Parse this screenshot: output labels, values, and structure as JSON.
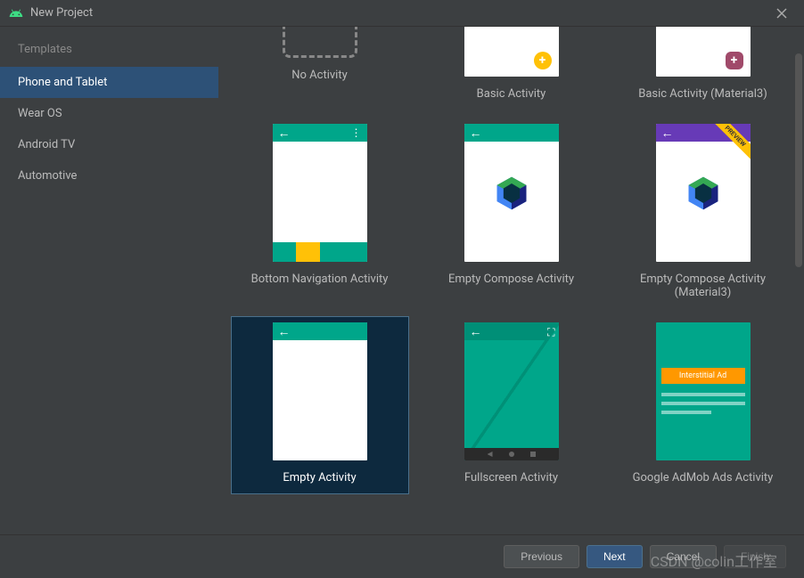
{
  "window": {
    "title": "New Project"
  },
  "sidebar": {
    "header": "Templates",
    "items": [
      {
        "label": "Phone and Tablet",
        "selected": true
      },
      {
        "label": "Wear OS",
        "selected": false
      },
      {
        "label": "Android TV",
        "selected": false
      },
      {
        "label": "Automotive",
        "selected": false
      }
    ]
  },
  "templates": [
    {
      "name": "No Activity",
      "selected": false,
      "variant": "no-activity"
    },
    {
      "name": "Basic Activity",
      "selected": false,
      "variant": "basic"
    },
    {
      "name": "Basic Activity (Material3)",
      "selected": false,
      "variant": "basic-m3"
    },
    {
      "name": "Bottom Navigation Activity",
      "selected": false,
      "variant": "bottom-nav"
    },
    {
      "name": "Empty Compose Activity",
      "selected": false,
      "variant": "compose"
    },
    {
      "name": "Empty Compose Activity (Material3)",
      "selected": false,
      "variant": "compose-m3"
    },
    {
      "name": "Empty Activity",
      "selected": true,
      "variant": "empty"
    },
    {
      "name": "Fullscreen Activity",
      "selected": false,
      "variant": "fullscreen"
    },
    {
      "name": "Google AdMob Ads Activity",
      "selected": false,
      "variant": "admob"
    }
  ],
  "admob": {
    "ad_label": "Interstitial Ad"
  },
  "preview_ribbon": "PREVIEW",
  "buttons": {
    "previous": "Previous",
    "next": "Next",
    "cancel": "Cancel",
    "finish": "Finish"
  },
  "watermark": "CSDN @colin工作室",
  "colors": {
    "teal": "#00a68a",
    "purple": "#673ab7",
    "yellow": "#ffc107",
    "orange": "#ff9800"
  }
}
